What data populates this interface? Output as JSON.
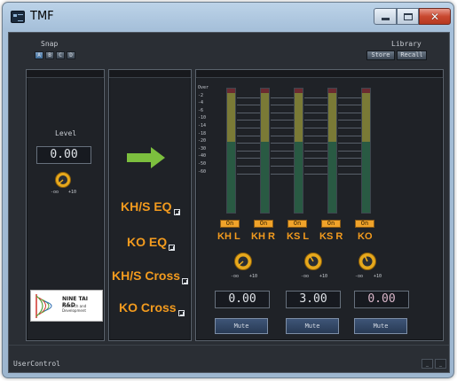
{
  "window": {
    "title": "TMF"
  },
  "snap": {
    "label": "Snap",
    "buttons": [
      "A",
      "B",
      "C",
      "D"
    ]
  },
  "library": {
    "label": "Library",
    "store_label": "Store",
    "recall_label": "Recall"
  },
  "level": {
    "label": "Level",
    "value": "0.00",
    "knob_min": "-oo",
    "knob_max": "+10"
  },
  "links": {
    "khs_eq": "KH/S EQ",
    "ko_eq": "KO EQ",
    "khs_cross": "KH/S Cross",
    "ko_cross": "KO Cross"
  },
  "logo": {
    "name": "NINE TAI R&D",
    "tagline": "Research and Development"
  },
  "meter_scale": [
    "Over",
    "-2",
    "-4",
    "-6",
    "-10",
    "-14",
    "-18",
    "-20",
    "-30",
    "-40",
    "-50",
    "-60"
  ],
  "channels": [
    {
      "label": "KH L",
      "on_label": "On"
    },
    {
      "label": "KH R",
      "on_label": "On"
    },
    {
      "label": "KS L",
      "on_label": "On"
    },
    {
      "label": "KS R",
      "on_label": "On"
    },
    {
      "label": "KO",
      "on_label": "On"
    }
  ],
  "outputs": [
    {
      "value": "0.00",
      "knob_min": "-oo",
      "knob_max": "+10",
      "mute_label": "Mute"
    },
    {
      "value": "3.00",
      "knob_min": "-oo",
      "knob_max": "+10",
      "mute_label": "Mute"
    },
    {
      "value": "0.00",
      "knob_min": "-oo",
      "knob_max": "+10",
      "mute_label": "Mute"
    }
  ],
  "status": {
    "text": "UserControl"
  },
  "colors": {
    "accent": "#f39b1e",
    "arrow": "#7cbf3e",
    "knob": "#f2b020"
  }
}
